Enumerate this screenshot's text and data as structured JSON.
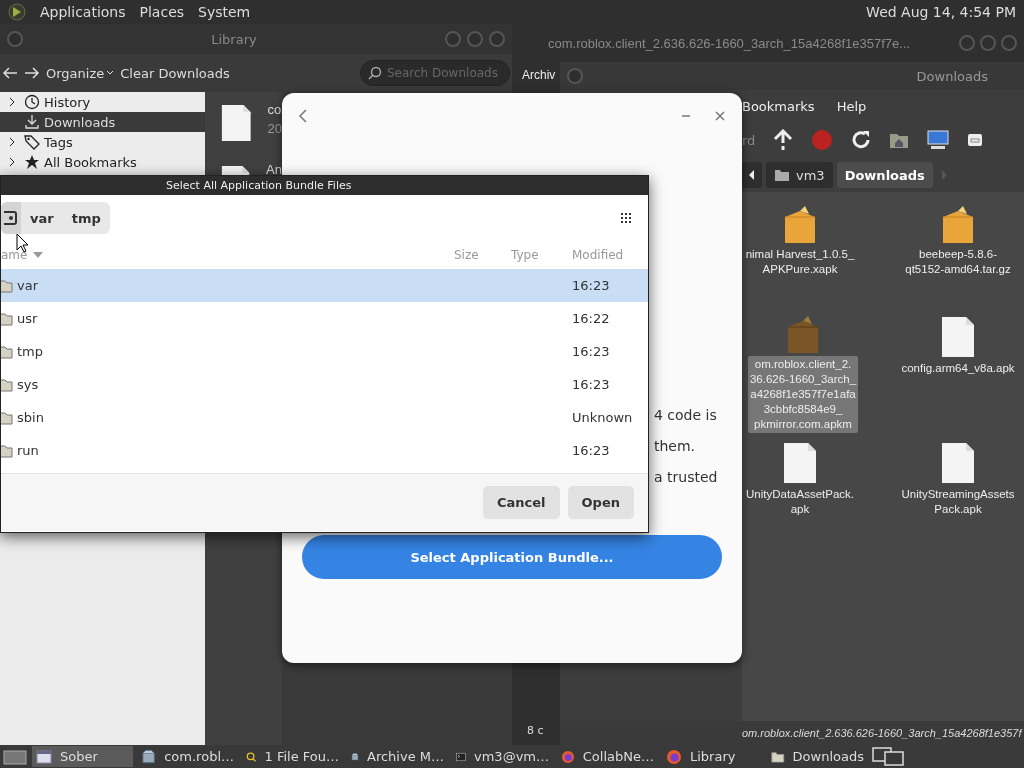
{
  "top_panel": {
    "menus": [
      "Applications",
      "Places",
      "System"
    ],
    "clock": "Wed Aug 14,  4:54 PM"
  },
  "library": {
    "title": "Library",
    "organize": "Organize",
    "clear": "Clear Downloads",
    "search_placeholder": "Search Downloads",
    "sidebar": [
      {
        "label": "History",
        "expandable": true,
        "selected": false
      },
      {
        "label": "Downloads",
        "expandable": false,
        "selected": true
      },
      {
        "label": "Tags",
        "expandable": true,
        "selected": false
      },
      {
        "label": "All Bookmarks",
        "expandable": true,
        "selected": false
      }
    ],
    "downloads": [
      {
        "name": "co",
        "detail": "20"
      },
      {
        "name": "An"
      }
    ]
  },
  "archive": {
    "title": "com.roblox.client_2.636.626-1660_3arch_15a4268f1e357f7e...",
    "tab": "Archiv",
    "status": "8 c"
  },
  "file_manager": {
    "title": "Downloads",
    "menus": [
      "Bookmarks",
      "Help"
    ],
    "toolbar_label": "rd",
    "path": [
      {
        "label": "vm3",
        "selected": false
      },
      {
        "label": "Downloads",
        "selected": true
      }
    ],
    "files": [
      {
        "name": "nimal Harvest_1.0.5_\nAPKPure.xapk",
        "kind": "package",
        "selected": false
      },
      {
        "name": "beebeep-5.8.6-\nqt5152-amd64.tar.gz",
        "kind": "package",
        "selected": false
      },
      {
        "name": "om.roblox.client_2.\n36.626-1660_3arch_\na4268f1e357f7e1afa\n3cbbfc8584e9_\npkmirror.com.apkm",
        "kind": "package",
        "selected": true
      },
      {
        "name": "config.arm64_v8a.apk",
        "kind": "file",
        "selected": false
      },
      {
        "name": "UnityDataAssetPack.\napk",
        "kind": "file",
        "selected": false
      },
      {
        "name": "UnityStreamingAssets\nPack.apk",
        "kind": "file",
        "selected": false
      }
    ],
    "status": "om.roblox.client_2.636.626-1660_3arch_15a4268f1e357f"
  },
  "sober": {
    "lines": [
      "4 code is",
      "them.",
      "a trusted"
    ],
    "button": "Select Application Bundle..."
  },
  "chooser": {
    "title": "Select All Application Bundle Files",
    "path": [
      "var",
      "tmp"
    ],
    "columns": [
      "ame",
      "Size",
      "Type",
      "Modified"
    ],
    "rows": [
      {
        "name": "var",
        "modified": "16:23",
        "selected": true
      },
      {
        "name": "usr",
        "modified": "16:22",
        "selected": false
      },
      {
        "name": "tmp",
        "modified": "16:23",
        "selected": false
      },
      {
        "name": "sys",
        "modified": "16:23",
        "selected": false
      },
      {
        "name": "sbin",
        "modified": "Unknown",
        "selected": false
      },
      {
        "name": "run",
        "modified": "16:23",
        "selected": false
      }
    ],
    "buttons": [
      "Cancel",
      "Open"
    ]
  },
  "taskbar": [
    {
      "label": "Sober",
      "selected": true
    },
    {
      "label": "com.robl…",
      "selected": false
    },
    {
      "label": "1 File Fou…",
      "selected": false
    },
    {
      "label": "Archive M…",
      "selected": false
    },
    {
      "label": "vm3@vm…",
      "selected": false
    },
    {
      "label": "CollabNe…",
      "selected": false
    },
    {
      "label": "Library",
      "selected": false
    },
    {
      "label": "Downloads",
      "selected": false
    }
  ]
}
